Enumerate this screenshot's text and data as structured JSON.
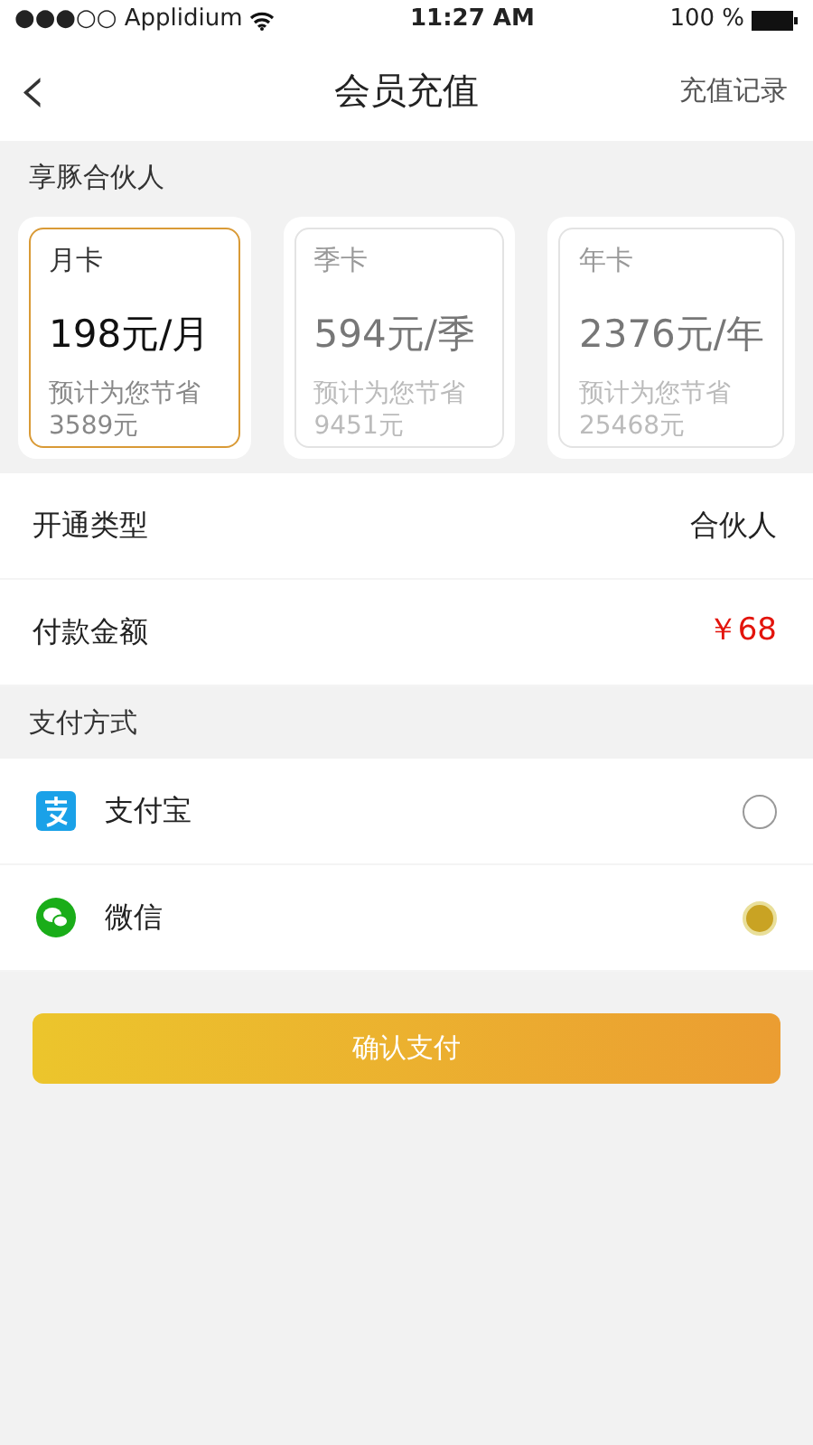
{
  "status_bar": {
    "carrier": "●●●○○ Applidium",
    "time": "11:27 AM",
    "battery": "100 %"
  },
  "nav": {
    "back": "‹",
    "title": "会员充值",
    "action": "充值记录"
  },
  "plan_section": {
    "title": "享豚合伙人"
  },
  "plans": [
    {
      "name": "月卡",
      "price": "198元/月",
      "note": "预计为您节省",
      "saving": "3589元",
      "selected": true
    },
    {
      "name": "季卡",
      "price": "594元/季",
      "note": "预计为您节省",
      "saving": "9451元",
      "selected": false
    },
    {
      "name": "年卡",
      "price": "2376元/年",
      "note": "预计为您节省",
      "saving": "25468元",
      "selected": false
    }
  ],
  "info_rows": [
    {
      "label": "开通类型",
      "value": "合伙人",
      "kind": "plain"
    },
    {
      "label": "付款金额",
      "value": "￥68",
      "kind": "price"
    }
  ],
  "payment_section": {
    "title": "支付方式"
  },
  "payment_methods": [
    {
      "name": "支付宝",
      "kind": "alipay",
      "selected": false
    },
    {
      "name": "微信",
      "kind": "wechat",
      "selected": true
    }
  ],
  "confirm_button": "确认支付"
}
